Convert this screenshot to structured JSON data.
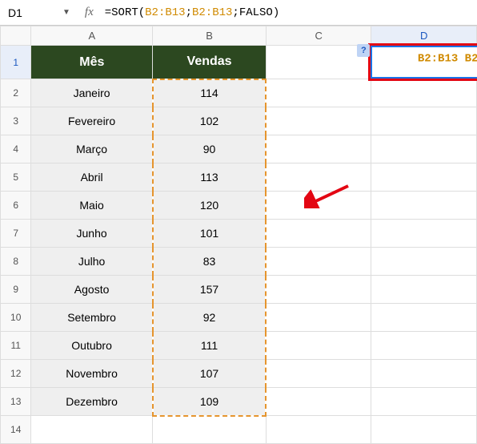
{
  "nameBox": "D1",
  "formulaBar": {
    "fx": "fx",
    "prefix": "=SORT(",
    "range1": "B2:B13",
    "sep1": ";",
    "range2": "B2:B13",
    "sep2": ";",
    "kw": "FALSO",
    "suffix": ")"
  },
  "columns": [
    "A",
    "B",
    "C",
    "D"
  ],
  "rowNumbers": [
    "1",
    "2",
    "3",
    "4",
    "5",
    "6",
    "7",
    "8",
    "9",
    "10",
    "11",
    "12",
    "13",
    "14"
  ],
  "headers": {
    "colA": "Mês",
    "colB": "Vendas"
  },
  "rows": [
    {
      "mes": "Janeiro",
      "vendas": "114"
    },
    {
      "mes": "Fevereiro",
      "vendas": "102"
    },
    {
      "mes": "Março",
      "vendas": "90"
    },
    {
      "mes": "Abril",
      "vendas": "113"
    },
    {
      "mes": "Maio",
      "vendas": "120"
    },
    {
      "mes": "Junho",
      "vendas": "101"
    },
    {
      "mes": "Julho",
      "vendas": "83"
    },
    {
      "mes": "Agosto",
      "vendas": "157"
    },
    {
      "mes": "Setembro",
      "vendas": "92"
    },
    {
      "mes": "Outubro",
      "vendas": "111"
    },
    {
      "mes": "Novembro",
      "vendas": "107"
    },
    {
      "mes": "Dezembro",
      "vendas": "109"
    }
  ],
  "helpBadge": "?",
  "activeCellFormula": {
    "prefix": "=SORT(",
    "range1": "B2:B13",
    "sep1": ";",
    "range2": "B2:B13",
    "sep2": ";",
    "kw": "FALSO",
    "suffix": ")"
  }
}
